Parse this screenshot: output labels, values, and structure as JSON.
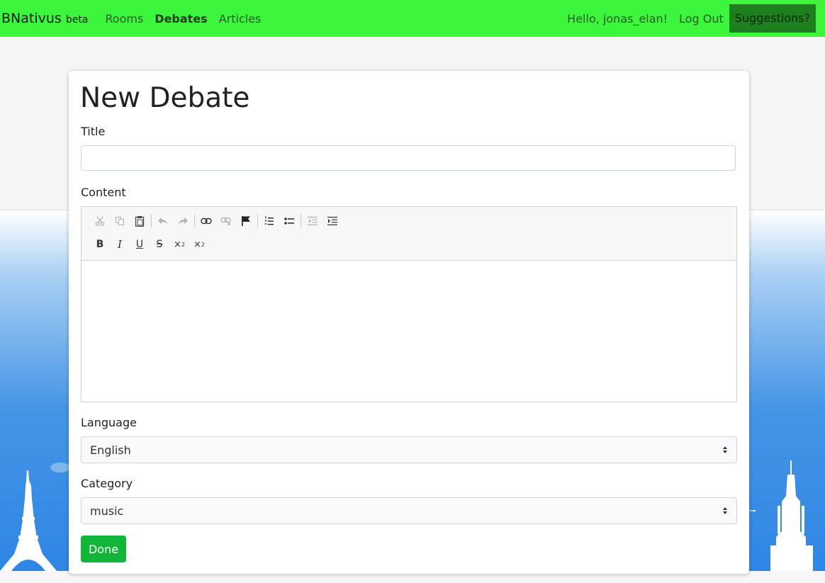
{
  "navbar": {
    "brand": "BNativus",
    "brand_tag": "beta",
    "links": [
      {
        "label": "Rooms",
        "active": false
      },
      {
        "label": "Debates",
        "active": true
      },
      {
        "label": "Articles",
        "active": false
      }
    ],
    "greeting": "Hello, jonas_elan!",
    "logout_label": "Log Out",
    "suggestions_label": "Suggestions?"
  },
  "form": {
    "heading": "New Debate",
    "title_label": "Title",
    "title_value": "",
    "content_label": "Content",
    "content_value": "",
    "language_label": "Language",
    "language_value": "English",
    "category_label": "Category",
    "category_value": "music",
    "submit_label": "Done"
  },
  "editor_toolbar": {
    "row1": [
      "cut-icon",
      "copy-icon",
      "paste-icon",
      "undo-icon",
      "redo-icon",
      "link-icon",
      "unlink-icon",
      "anchor-flag-icon",
      "numbered-list-icon",
      "bulleted-list-icon",
      "outdent-icon",
      "indent-icon"
    ],
    "row2": [
      "bold-icon",
      "italic-icon",
      "underline-icon",
      "strikethrough-icon",
      "subscript-icon",
      "superscript-icon"
    ]
  },
  "colors": {
    "navbar_bg": "#3df53d",
    "suggestions_bg": "#1e7f1e",
    "done_button": "#11b53a",
    "sky_bottom": "#2f86e4"
  }
}
